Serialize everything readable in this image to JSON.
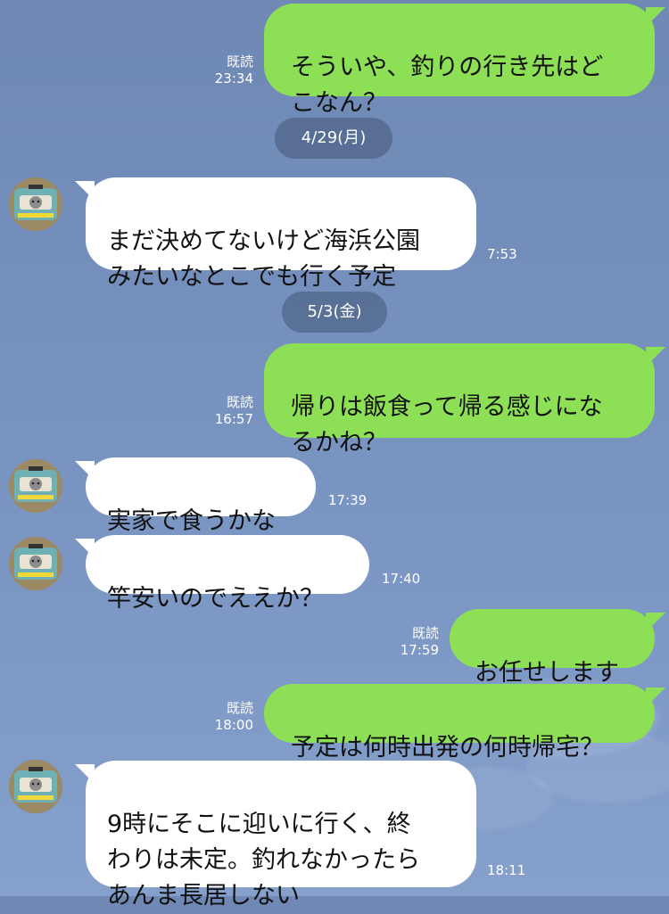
{
  "messages": [
    {
      "dir": "out",
      "lines": "そういや、釣りの行き先はど\nこなん？",
      "read": "既読",
      "time": "23:34"
    },
    {
      "date": "4/29(月)"
    },
    {
      "dir": "in",
      "lines": "まだ決めてないけど海浜公園\nみたいなとこでも行く予定",
      "time": "7:53"
    },
    {
      "date": "5/3(金)"
    },
    {
      "dir": "out",
      "lines": "帰りは飯食って帰る感じにな\nるかね？",
      "read": "既読",
      "time": "16:57"
    },
    {
      "dir": "in",
      "lines": "実家で食うかな",
      "time": "17:39"
    },
    {
      "dir": "in",
      "lines": "竿安いのでええか？",
      "time": "17:40"
    },
    {
      "dir": "out",
      "lines": "お任せします",
      "read": "既読",
      "time": "17:59"
    },
    {
      "dir": "out",
      "lines": "予定は何時出発の何時帰宅？",
      "read": "既読",
      "time": "18:00"
    },
    {
      "dir": "in",
      "lines": "9時にそこに迎いに行く、終\nわりは未定。釣れなかったら\nあんま長居しない",
      "time": "18:11"
    }
  ],
  "avatar": {
    "icon": "cat-in-bus-photo"
  },
  "colors": {
    "outgoing_bubble": "#8de055",
    "incoming_bubble": "#ffffff",
    "background": "#7590bd",
    "date_pill": "#495c80"
  }
}
